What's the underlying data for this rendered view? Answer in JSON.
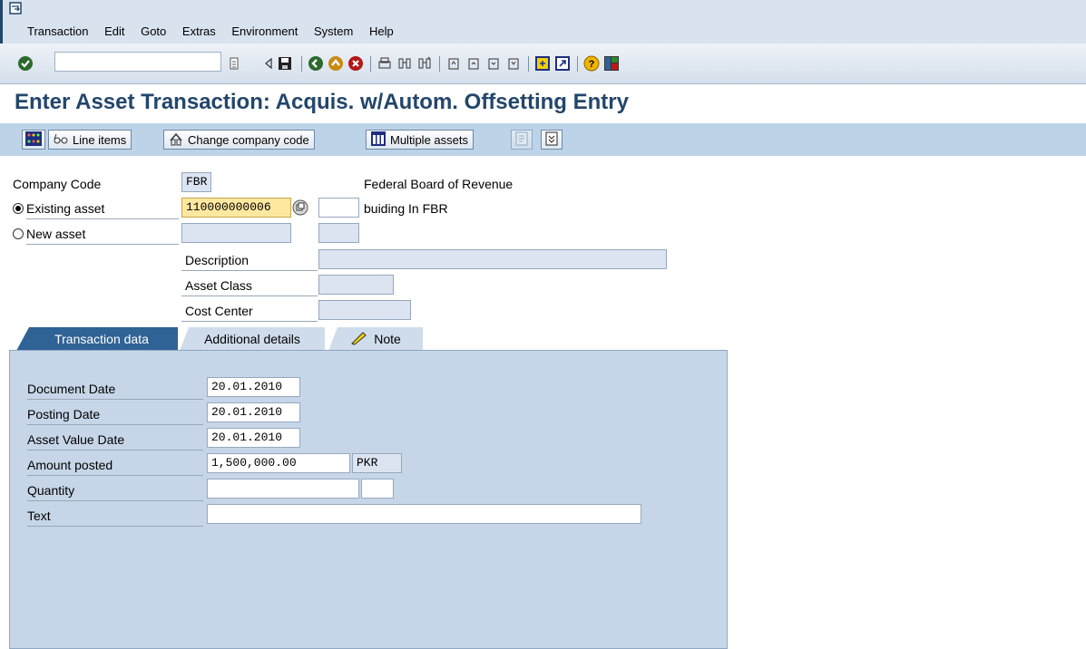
{
  "menu": {
    "items": [
      "Transaction",
      "Edit",
      "Goto",
      "Extras",
      "Environment",
      "System",
      "Help"
    ]
  },
  "toolbar": {
    "command_field_value": "",
    "icons": [
      "enter-icon",
      "command-history-icon",
      "back-arrow-icon",
      "save-icon",
      "back-icon",
      "exit-icon",
      "cancel-icon",
      "print-icon",
      "find-icon",
      "find-next-icon",
      "first-page-icon",
      "previous-page-icon",
      "next-page-icon",
      "last-page-icon",
      "create-session-icon",
      "shortcut-icon",
      "help-icon",
      "layout-icon"
    ]
  },
  "title": "Enter Asset Transaction: Acquis. w/Autom. Offsetting Entry",
  "app_toolbar": {
    "line_items": "Line items",
    "change_company_code": "Change company code",
    "multiple_assets": "Multiple assets"
  },
  "header": {
    "company_code_label": "Company Code",
    "company_code_value": "FBR",
    "company_name": "Federal Board of Revenue",
    "existing_asset_label": "Existing asset",
    "existing_asset_value": "110000000006",
    "existing_asset_subnumber": "",
    "existing_asset_description": "buiding In FBR",
    "new_asset_label": "New asset",
    "new_asset_value": "",
    "description_label": "Description",
    "description_value": "",
    "asset_class_label": "Asset Class",
    "asset_class_value": "",
    "cost_center_label": "Cost Center",
    "cost_center_value": ""
  },
  "tabs": {
    "transaction_data": "Transaction data",
    "additional_details": "Additional details",
    "note": "Note"
  },
  "transaction": {
    "document_date_label": "Document Date",
    "document_date": "20.01.2010",
    "posting_date_label": "Posting Date",
    "posting_date": "20.01.2010",
    "asset_value_date_label": "Asset Value Date",
    "asset_value_date": "20.01.2010",
    "amount_posted_label": "Amount posted",
    "amount_posted": "1,500,000.00",
    "currency": "PKR",
    "quantity_label": "Quantity",
    "quantity": "",
    "quantity_unit": "",
    "text_label": "Text",
    "text": ""
  },
  "colors": {
    "title": "#23466b",
    "active_tab": "#2f6396",
    "panel": "#c6d6e8",
    "app_toolbar": "#bdd3e8",
    "highlight_field": "#fde8a0"
  }
}
